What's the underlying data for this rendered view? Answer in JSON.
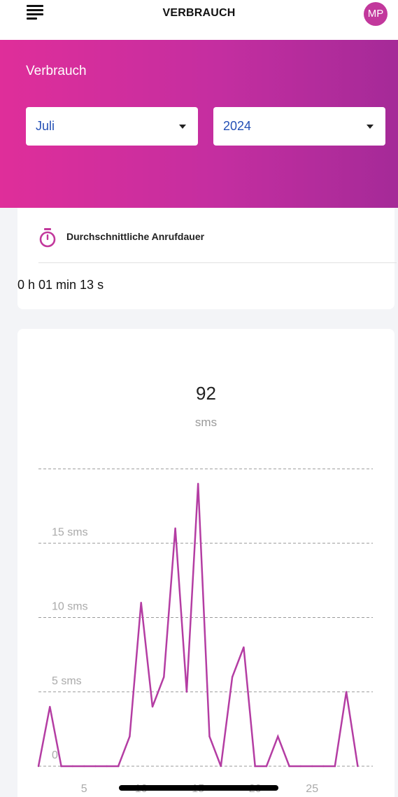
{
  "header": {
    "title": "VERBRAUCH",
    "avatar_initials": "MP",
    "menu_icon": "menu-icon"
  },
  "hero": {
    "label": "Verbrauch",
    "month_select": {
      "value": "Juli"
    },
    "year_select": {
      "value": "2024"
    }
  },
  "call_duration_card": {
    "icon": "stopwatch-icon",
    "title": "Durchschnittliche Anrufdauer",
    "value": "0 h 01 min 13 s"
  },
  "sms_card": {
    "total": "92",
    "unit": "sms"
  },
  "colors": {
    "accent": "#c2389c",
    "hero_gradient": [
      "#df2e9a",
      "#a52a98"
    ],
    "line": "#b43da3",
    "select_text": "#2450b5"
  },
  "chart_data": {
    "type": "line",
    "title": "",
    "xlabel": "",
    "ylabel": "",
    "ylim": [
      0,
      20
    ],
    "grid": true,
    "y_ticks": [
      {
        "value": 0,
        "label": "0"
      },
      {
        "value": 5,
        "label": "5 sms"
      },
      {
        "value": 10,
        "label": "10 sms"
      },
      {
        "value": 15,
        "label": "15 sms"
      },
      {
        "value": 20,
        "label": ""
      }
    ],
    "x_ticks": [
      {
        "value": 5,
        "label": "5"
      },
      {
        "value": 10,
        "label": "10"
      },
      {
        "value": 15,
        "label": "15"
      },
      {
        "value": 20,
        "label": "20"
      },
      {
        "value": 25,
        "label": "25"
      }
    ],
    "series": [
      {
        "x": [
          1,
          2,
          3,
          4,
          5,
          6,
          7,
          8,
          9,
          10,
          11,
          12,
          13,
          14,
          15,
          16,
          17,
          18,
          19,
          20,
          21,
          22,
          23,
          24,
          25,
          26,
          27,
          28,
          29
        ],
        "values": [
          0,
          4,
          0,
          0,
          0,
          0,
          0,
          0,
          2,
          11,
          4,
          6,
          16,
          5,
          19,
          2,
          0,
          6,
          8,
          0,
          0,
          2,
          0,
          0,
          0,
          0,
          0,
          5,
          0
        ]
      }
    ]
  }
}
